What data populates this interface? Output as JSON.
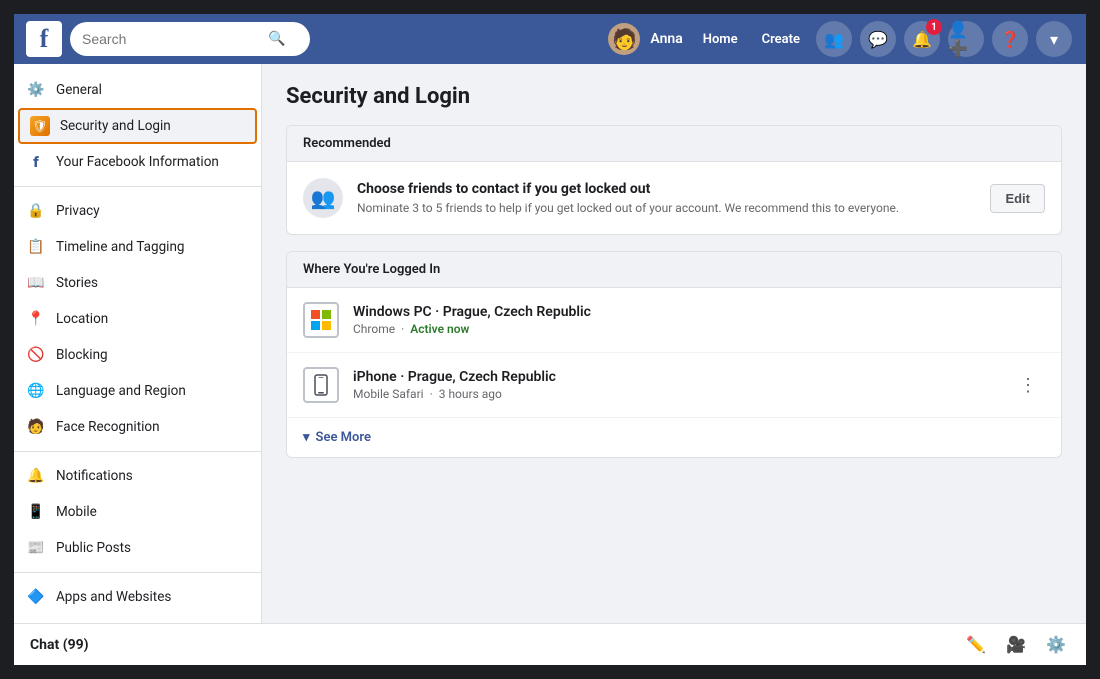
{
  "navbar": {
    "search_placeholder": "Search",
    "user_name": "Anna",
    "nav_items": [
      "Home",
      "Create"
    ],
    "icons": {
      "friends": "👥",
      "messenger": "💬",
      "notifications": "🔔",
      "friend_requests": "👥",
      "help": "❓",
      "dropdown": "▾"
    },
    "notification_badge": "1"
  },
  "sidebar": {
    "items": [
      {
        "id": "general",
        "label": "General",
        "icon": "⚙️",
        "active": false
      },
      {
        "id": "security-login",
        "label": "Security and Login",
        "icon": "🛡",
        "active": true
      },
      {
        "id": "your-facebook",
        "label": "Your Facebook Information",
        "icon": "fb",
        "active": false
      },
      {
        "id": "privacy",
        "label": "Privacy",
        "icon": "🔒",
        "active": false
      },
      {
        "id": "timeline-tagging",
        "label": "Timeline and Tagging",
        "icon": "📋",
        "active": false
      },
      {
        "id": "stories",
        "label": "Stories",
        "icon": "📖",
        "active": false
      },
      {
        "id": "location",
        "label": "Location",
        "icon": "📍",
        "active": false
      },
      {
        "id": "blocking",
        "label": "Blocking",
        "icon": "🚫",
        "active": false
      },
      {
        "id": "language-region",
        "label": "Language and Region",
        "icon": "🌐",
        "active": false
      },
      {
        "id": "face-recognition",
        "label": "Face Recognition",
        "icon": "🧑",
        "active": false
      },
      {
        "id": "notifications",
        "label": "Notifications",
        "icon": "🔔",
        "active": false
      },
      {
        "id": "mobile",
        "label": "Mobile",
        "icon": "📱",
        "active": false
      },
      {
        "id": "public-posts",
        "label": "Public Posts",
        "icon": "📰",
        "active": false
      },
      {
        "id": "apps-websites",
        "label": "Apps and Websites",
        "icon": "🔷",
        "active": false
      }
    ]
  },
  "content": {
    "page_title": "Security and Login",
    "recommended_section": {
      "header": "Recommended",
      "row": {
        "title": "Choose friends to contact if you get locked out",
        "description": "Nominate 3 to 5 friends to help if you get locked out of your account. We recommend this to everyone.",
        "button_label": "Edit"
      }
    },
    "logged_in_section": {
      "header": "Where You're Logged In",
      "devices": [
        {
          "name": "Windows PC · Prague, Czech Republic",
          "browser": "Chrome",
          "status": "Active now",
          "status_type": "active",
          "icon": "💻"
        },
        {
          "name": "iPhone · Prague, Czech Republic",
          "browser": "Mobile Safari",
          "time": "3 hours ago",
          "status_type": "inactive",
          "icon": "📱"
        }
      ],
      "see_more_label": "See More"
    }
  },
  "chat_bar": {
    "label": "Chat (99)"
  }
}
